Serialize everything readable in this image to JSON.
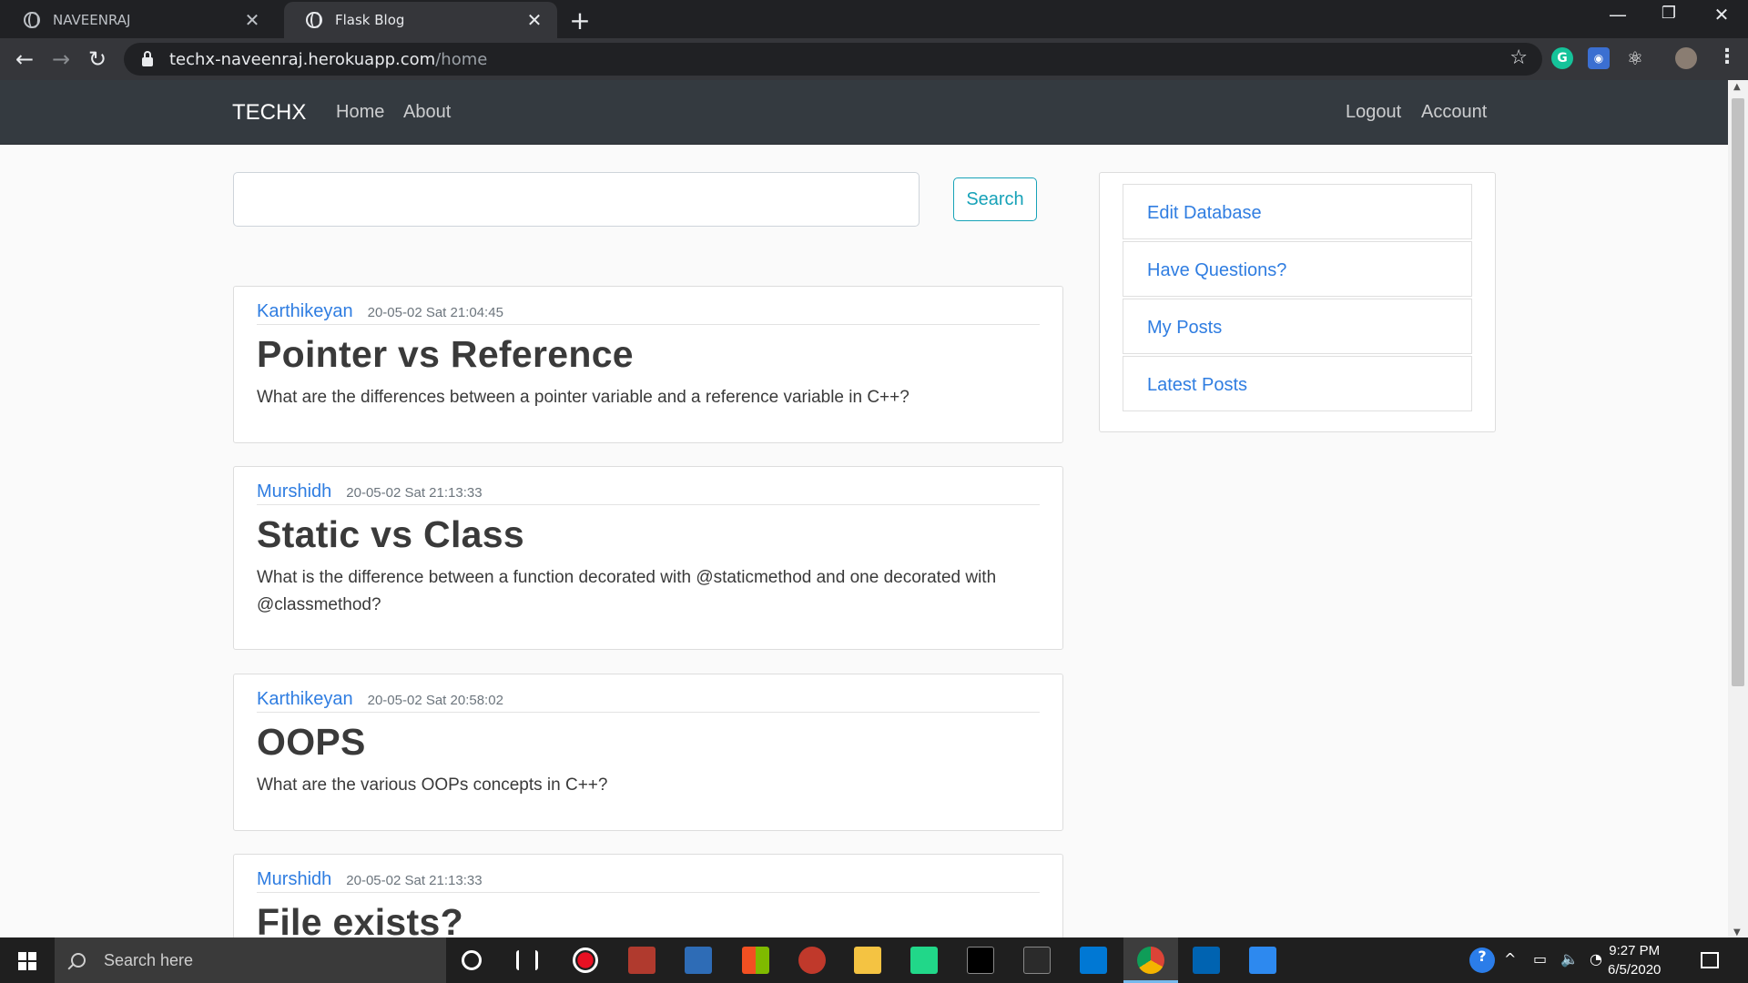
{
  "browser": {
    "tabs": [
      {
        "title": "NAVEENRAJ",
        "active": false
      },
      {
        "title": "Flask Blog",
        "active": true
      }
    ],
    "url_host": "techx-naveenraj.herokuapp.com",
    "url_path": "/home"
  },
  "site": {
    "brand": "TECHX",
    "nav_left": [
      "Home",
      "About"
    ],
    "nav_right": [
      "Logout",
      "Account"
    ]
  },
  "search": {
    "placeholder": "",
    "button": "Search"
  },
  "posts": [
    {
      "author": "Karthikeyan",
      "date": "20-05-02 Sat 21:04:45",
      "title": "Pointer vs Reference",
      "content": "What are the differences between a pointer variable and a reference variable in C++?"
    },
    {
      "author": "Murshidh",
      "date": "20-05-02 Sat 21:13:33",
      "title": "Static vs Class",
      "content": "What is the difference between a function decorated with @staticmethod and one decorated with @classmethod?"
    },
    {
      "author": "Karthikeyan",
      "date": "20-05-02 Sat 20:58:02",
      "title": "OOPS",
      "content": "What are the various OOPs concepts in C++?"
    },
    {
      "author": "Murshidh",
      "date": "20-05-02 Sat 21:13:33",
      "title": "File exists?",
      "content": ""
    }
  ],
  "sidebar": {
    "items": [
      "Edit Database",
      "Have Questions?",
      "My Posts",
      "Latest Posts"
    ]
  },
  "taskbar": {
    "search_placeholder": "Search here",
    "time": "9:27 PM",
    "date": "6/5/2020"
  },
  "colors": {
    "navbar": "#343a40",
    "link": "#2f7de1",
    "search_button": "#17a2b8"
  }
}
